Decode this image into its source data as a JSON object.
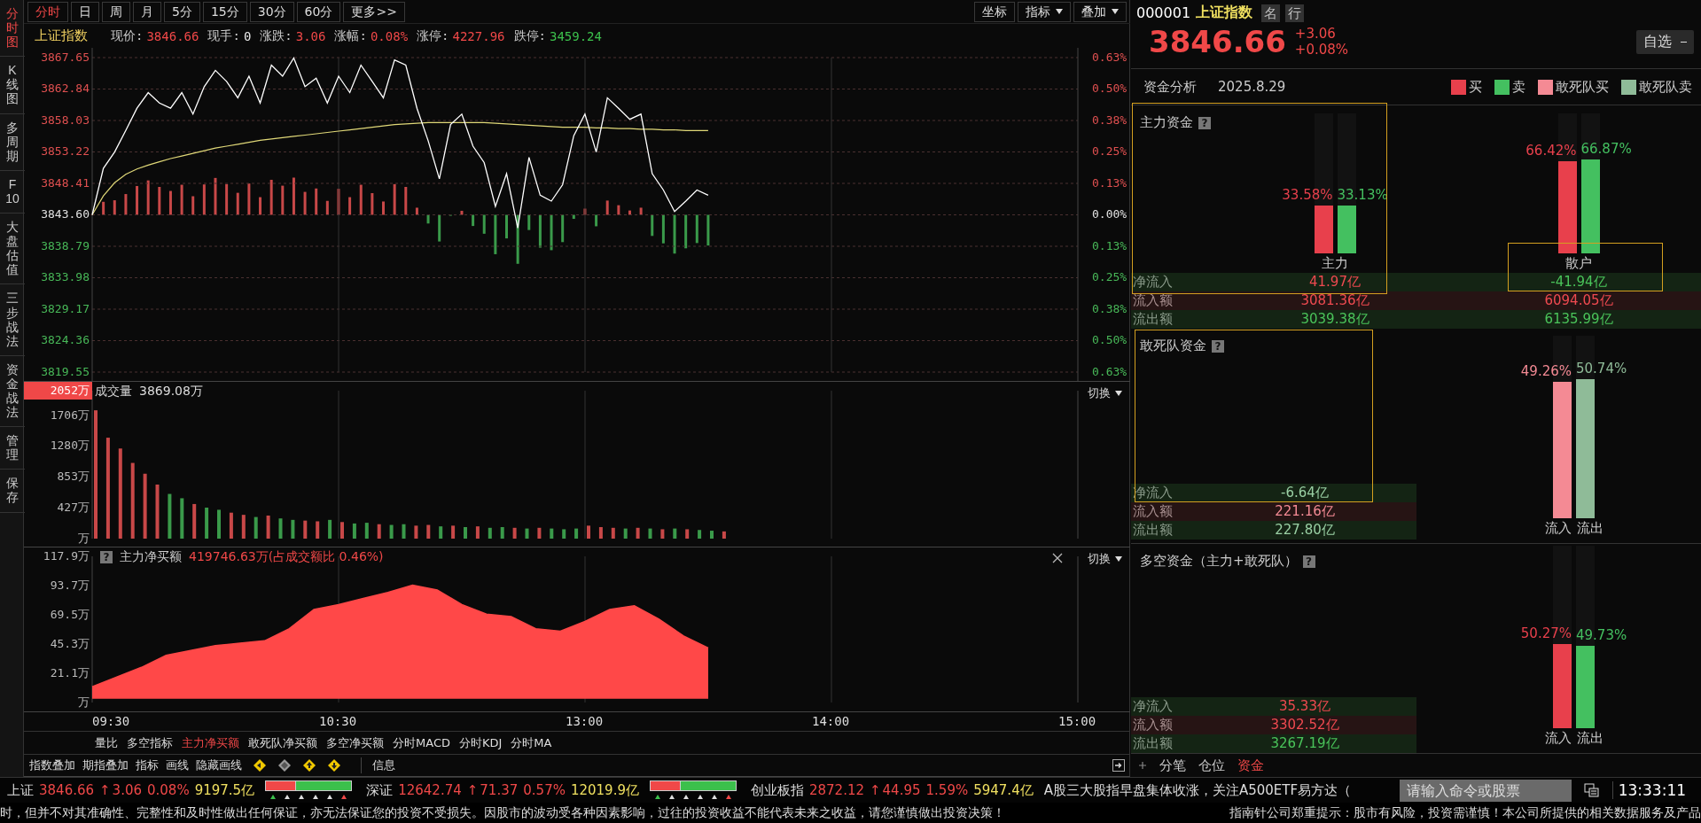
{
  "sidebar": {
    "items": [
      {
        "label": "分时图",
        "selected": true
      },
      {
        "label": "K线图",
        "selected": false
      },
      {
        "label": "多周期",
        "selected": false
      },
      {
        "label": "F10",
        "selected": false
      },
      {
        "label": "大盘估值",
        "selected": false
      },
      {
        "label": "三步战法",
        "selected": false
      },
      {
        "label": "资金战法",
        "selected": false
      },
      {
        "label": "管理",
        "selected": false
      },
      {
        "label": "保存",
        "selected": false
      }
    ]
  },
  "period_tabs": [
    {
      "label": "分时",
      "selected": true
    },
    {
      "label": "日",
      "selected": false
    },
    {
      "label": "周",
      "selected": false
    },
    {
      "label": "月",
      "selected": false
    },
    {
      "label": "5分",
      "selected": false
    },
    {
      "label": "15分",
      "selected": false
    },
    {
      "label": "30分",
      "selected": false
    },
    {
      "label": "60分",
      "selected": false
    },
    {
      "label": "更多>>",
      "selected": false
    }
  ],
  "chart_tools": [
    {
      "label": "坐标",
      "dropdown": false
    },
    {
      "label": "指标",
      "dropdown": true
    },
    {
      "label": "叠加",
      "dropdown": true
    }
  ],
  "quote_line": {
    "name": "上证指数",
    "fields": [
      {
        "label": "现价:",
        "value": "3846.66",
        "color": "#f04848"
      },
      {
        "label": "现手:",
        "value": "0",
        "color": "#e8e8e8"
      },
      {
        "label": "涨跌:",
        "value": "3.06",
        "color": "#f04848"
      },
      {
        "label": "涨幅:",
        "value": "0.08%",
        "color": "#f04848"
      },
      {
        "label": "涨停:",
        "value": "4227.96",
        "color": "#f04848"
      },
      {
        "label": "跌停:",
        "value": "3459.24",
        "color": "#3cc04c"
      }
    ]
  },
  "price_panel": {
    "right_axis_labels": [
      "0.63%",
      "0.50%",
      "0.38%",
      "0.25%",
      "0.13%",
      "0.00%",
      "0.13%",
      "0.25%",
      "0.38%",
      "0.50%",
      "0.63%"
    ],
    "chart_data": {
      "type": "line",
      "grid": true,
      "ylim": [
        3819.55,
        3867.65
      ],
      "categories": [
        null,
        null,
        null,
        null,
        null,
        null,
        null,
        null,
        null,
        null,
        null,
        null,
        null,
        null,
        null,
        null,
        null,
        null,
        null,
        null,
        null,
        null,
        null,
        null,
        null,
        null,
        null,
        null,
        null,
        null,
        null,
        null,
        null,
        null,
        null,
        null,
        null,
        null,
        null,
        null,
        null,
        null,
        null,
        null,
        null,
        null,
        null,
        null,
        null,
        null,
        null,
        null,
        null,
        null,
        null,
        null
      ],
      "series": [
        {
          "color": "#ffffff",
          "values": [
            3843.6,
            3850.7,
            3853.2,
            3856.5,
            3859.9,
            3862.3,
            3860.7,
            3859.9,
            3862.3,
            3859.0,
            3863.2,
            3865.7,
            3864.0,
            3861.5,
            3864.8,
            3860.7,
            3866.5,
            3864.8,
            3867.6,
            3863.2,
            3864.5,
            3860.7,
            3864.8,
            3862.3,
            3866.5,
            3864.0,
            3861.5,
            3867.3,
            3866.5,
            3859.9,
            3854.9,
            3849.1,
            3857.4,
            3859.0,
            3854.1,
            3851.6,
            3844.9,
            3849.9,
            3841.6,
            3852.4,
            3846.6,
            3845.7,
            3848.2,
            3855.7,
            3859.0,
            3853.2,
            3861.5,
            3859.9,
            3858.2,
            3859.0,
            3849.9,
            3847.4,
            3844.1,
            3845.7,
            3847.4,
            3846.6
          ]
        },
        {
          "color": "#e0d878",
          "values": [
            3843.6,
            3846.5,
            3848.5,
            3849.8,
            3850.6,
            3851.2,
            3851.7,
            3852.2,
            3852.6,
            3853.0,
            3853.4,
            3853.8,
            3854.1,
            3854.4,
            3854.7,
            3855.0,
            3855.2,
            3855.4,
            3855.6,
            3855.8,
            3856.0,
            3856.2,
            3856.4,
            3856.6,
            3856.8,
            3857.0,
            3857.2,
            3857.4,
            3857.5,
            3857.6,
            3857.7,
            3857.7,
            3857.7,
            3857.7,
            3857.7,
            3857.7,
            3857.6,
            3857.5,
            3857.4,
            3857.3,
            3857.2,
            3857.1,
            3857.0,
            3857.0,
            3857.0,
            3856.9,
            3856.9,
            3856.8,
            3856.8,
            3856.7,
            3856.7,
            3856.6,
            3856.6,
            3856.5,
            3856.5,
            3856.5
          ]
        }
      ],
      "yticks": [
        {
          "value": 3867.65,
          "label": "3867.65"
        },
        {
          "value": 3862.84,
          "label": "3862.84"
        },
        {
          "value": 3858.03,
          "label": "3858.03"
        },
        {
          "value": 3853.22,
          "label": "3853.22"
        },
        {
          "value": 3848.41,
          "label": "3848.41"
        },
        {
          "value": 3843.6,
          "label": "3843.60"
        },
        {
          "value": 3838.79,
          "label": "3838.79"
        },
        {
          "value": 3833.98,
          "label": "3833.98"
        },
        {
          "value": 3829.17,
          "label": "3829.17"
        },
        {
          "value": 3824.36,
          "label": "3824.36"
        },
        {
          "value": 3819.55,
          "label": "3819.55"
        }
      ]
    }
  },
  "volume_panel": {
    "title": "成交量",
    "value": "3869.08万",
    "switch_label": "切换",
    "chart_data": {
      "type": "bar",
      "stacked": true,
      "ylim": [
        0,
        2052
      ],
      "categories": [
        null,
        null,
        null,
        null,
        null,
        null,
        null,
        null,
        null,
        null,
        null,
        null,
        null,
        null,
        null,
        null,
        null,
        null,
        null,
        null,
        null,
        null,
        null,
        null,
        null,
        null,
        null,
        null,
        null,
        null,
        null,
        null,
        null,
        null,
        null,
        null,
        null,
        null,
        null,
        null,
        null,
        null,
        null,
        null,
        null,
        null,
        null,
        null,
        null,
        null,
        null,
        null
      ],
      "series": [
        {
          "color": "#c84848",
          "values": [
            1780,
            1400,
            1250,
            1050,
            900,
            750,
            null,
            null,
            480,
            null,
            null,
            360,
            330,
            null,
            320,
            null,
            null,
            250,
            240,
            null,
            230,
            null,
            null,
            200,
            null,
            null,
            180,
            190,
            null,
            180,
            null,
            170,
            null,
            null,
            150,
            null,
            150,
            null,
            null,
            null,
            180,
            160,
            150,
            null,
            150,
            null,
            130,
            null,
            130,
            null,
            null,
            100
          ]
        },
        {
          "color": "#3a9a4a",
          "values": [
            null,
            null,
            null,
            null,
            null,
            null,
            620,
            560,
            null,
            430,
            400,
            null,
            null,
            300,
            null,
            280,
            260,
            null,
            null,
            260,
            null,
            210,
            220,
            null,
            190,
            200,
            null,
            null,
            170,
            null,
            160,
            null,
            150,
            160,
            null,
            140,
            null,
            140,
            130,
            140,
            null,
            null,
            null,
            140,
            null,
            140,
            null,
            140,
            null,
            120,
            110,
            null
          ]
        }
      ],
      "yticks": [
        {
          "value": 2052,
          "label": "2052万"
        },
        {
          "value": 1706,
          "label": "1706万"
        },
        {
          "value": 1280,
          "label": "1280万"
        },
        {
          "value": 853,
          "label": "853万"
        },
        {
          "value": 427,
          "label": "427万"
        },
        {
          "value": 0,
          "label": "万"
        }
      ]
    }
  },
  "netbuy_panel": {
    "help": "?",
    "title": "主力净买额",
    "value": "419746.63万(占成交额比 0.46%)",
    "switch_label": "切换",
    "chart_data": {
      "type": "area",
      "ylim": [
        -3.1,
        117.9
      ],
      "categories": [
        null,
        null,
        null,
        null,
        null,
        null,
        null,
        null,
        null,
        null,
        null,
        null,
        null,
        null,
        null,
        null,
        null,
        null,
        null,
        null,
        null,
        null,
        null,
        null,
        null,
        null
      ],
      "series": [
        {
          "color": "#ff4848",
          "values": [
            10,
            18,
            26,
            36,
            40,
            44,
            46,
            48,
            58,
            74,
            78,
            83,
            88,
            94,
            90,
            78,
            70,
            68,
            58,
            56,
            64,
            74,
            77,
            66,
            52,
            42
          ]
        }
      ],
      "yticks": [
        {
          "value": 117.9,
          "label": "117.9万"
        },
        {
          "value": 93.7,
          "label": "93.7万"
        },
        {
          "value": 69.5,
          "label": "69.5万"
        },
        {
          "value": 45.3,
          "label": "45.3万"
        },
        {
          "value": 21.1,
          "label": "21.1万"
        },
        {
          "value": -3.1,
          "label": "万"
        }
      ]
    }
  },
  "time_axis": [
    "09:30",
    "10:30",
    "13:00",
    "14:00",
    "15:00"
  ],
  "indicator_tabs": [
    {
      "label": "量比",
      "selected": false
    },
    {
      "label": "多空指标",
      "selected": false
    },
    {
      "label": "主力净买额",
      "selected": true
    },
    {
      "label": "敢死队净买额",
      "selected": false
    },
    {
      "label": "多空净买额",
      "selected": false
    },
    {
      "label": "分时MACD",
      "selected": false
    },
    {
      "label": "分时KDJ",
      "selected": false
    },
    {
      "label": "分时MA",
      "selected": false
    }
  ],
  "bottom_tools": [
    "指数叠加",
    "期指叠加",
    "指标",
    "画线",
    "隐藏画线"
  ],
  "info_tab": "信息",
  "right_panel": {
    "code": "000001",
    "name": "上证指数",
    "name_buttons": [
      "名",
      "行"
    ],
    "price": "3846.66",
    "change": "+3.06",
    "change_pct": "+0.08%",
    "watch_button": "自选",
    "analysis_title": "资金分析",
    "date": "2025.8.29",
    "legend": [
      {
        "label": "买",
        "color": "#e8404c"
      },
      {
        "label": "卖",
        "color": "#44c060"
      },
      {
        "label": "敢死队买",
        "color": "#f48a94"
      },
      {
        "label": "敢死队卖",
        "color": "#8fbb98"
      }
    ],
    "sections": [
      {
        "kind": "groups",
        "title": "主力资金",
        "help": "?",
        "groups": [
          {
            "name": "主力",
            "bars": [
              {
                "pct": "33.58%",
                "level": 0.34,
                "color": "#e8404c"
              },
              {
                "pct": "33.13%",
                "level": 0.34,
                "color": "#44c060"
              }
            ]
          },
          {
            "name": "散户",
            "bars": [
              {
                "pct": "66.42%",
                "level": 0.66,
                "color": "#e8404c"
              },
              {
                "pct": "66.87%",
                "level": 0.67,
                "color": "#44c060"
              }
            ]
          }
        ],
        "rows": [
          {
            "label": "净流入",
            "kind": "net",
            "values": [
              {
                "text": "41.97亿",
                "color": "#f04a50"
              },
              {
                "text": "-41.94亿",
                "color": "#4ac45a"
              }
            ]
          },
          {
            "label": "流入额",
            "kind": "in",
            "values": [
              {
                "text": "3081.36亿",
                "color": "#f04a50"
              },
              {
                "text": "6094.05亿",
                "color": "#f04a50"
              }
            ]
          },
          {
            "label": "流出额",
            "kind": "out",
            "values": [
              {
                "text": "3039.38亿",
                "color": "#4ac45a"
              },
              {
                "text": "6135.99亿",
                "color": "#4ac45a"
              }
            ]
          }
        ]
      },
      {
        "kind": "single",
        "title": "敢死队资金",
        "help": "?",
        "bars": [
          {
            "label": "流入",
            "pct": "49.26%",
            "level": 0.75,
            "color": "#f48a94"
          },
          {
            "label": "流出",
            "pct": "50.74%",
            "level": 0.76,
            "color": "#8fbb98"
          }
        ],
        "rows": [
          {
            "label": "净流入",
            "kind": "net",
            "values": [
              {
                "text": "-6.64亿",
                "color": "#9ad0a4"
              }
            ]
          },
          {
            "label": "流入额",
            "kind": "in",
            "values": [
              {
                "text": "221.16亿",
                "color": "#f48a94"
              }
            ]
          },
          {
            "label": "流出额",
            "kind": "out",
            "values": [
              {
                "text": "227.80亿",
                "color": "#9ad0a4"
              }
            ]
          }
        ]
      },
      {
        "kind": "single",
        "title": "多空资金（主力+敢死队）",
        "help": "?",
        "bars": [
          {
            "label": "流入",
            "pct": "50.27%",
            "level": 0.46,
            "color": "#e8404c"
          },
          {
            "label": "流出",
            "pct": "49.73%",
            "level": 0.45,
            "color": "#44c060"
          }
        ],
        "rows": [
          {
            "label": "净流入",
            "kind": "net",
            "values": [
              {
                "text": "35.33亿",
                "color": "#f04a50"
              }
            ]
          },
          {
            "label": "流入额",
            "kind": "in",
            "values": [
              {
                "text": "3302.52亿",
                "color": "#f04a50"
              }
            ]
          },
          {
            "label": "流出额",
            "kind": "out",
            "values": [
              {
                "text": "3267.19亿",
                "color": "#4ac45a"
              }
            ]
          }
        ]
      }
    ],
    "bottom_tabs": [
      {
        "label": "分笔",
        "selected": false
      },
      {
        "label": "仓位",
        "selected": false
      },
      {
        "label": "资金",
        "selected": true
      }
    ]
  },
  "status_bar": {
    "indices": [
      {
        "name": "上证",
        "price": "3846.66",
        "arrow": "↑",
        "change": "3.06",
        "pct": "0.08%",
        "amount": "9197.5亿",
        "color": "#f04848",
        "breadth_bar": true
      },
      {
        "name": "深证",
        "price": "12642.74",
        "arrow": "↑",
        "change": "71.37",
        "pct": "0.57%",
        "amount": "12019.9亿",
        "color": "#f04848",
        "breadth_bar": true
      },
      {
        "name": "创业板指",
        "price": "2872.12",
        "arrow": "↑",
        "change": "44.95",
        "pct": "1.59%",
        "amount": "5947.4亿",
        "color": "#f04848",
        "breadth_bar": false
      }
    ],
    "news": "A股三大股指早盘集体收涨，关注A500ETF易方达（",
    "command_placeholder": "请输入命令或股票",
    "time": "13:33:11"
  },
  "disclaimer": [
    "时，但并不对其准确性、完整性和及时性做出任何保证，亦无法保证您的投资不受损失。因股市的波动受各种因素影响，过往的投资收益不能代表未来之收益，请您谨慎做出投资决策！",
    "指南针公司郑重提示：股市有风险，投资需谨慎！本公司所提供的相关数据服务及产品"
  ]
}
